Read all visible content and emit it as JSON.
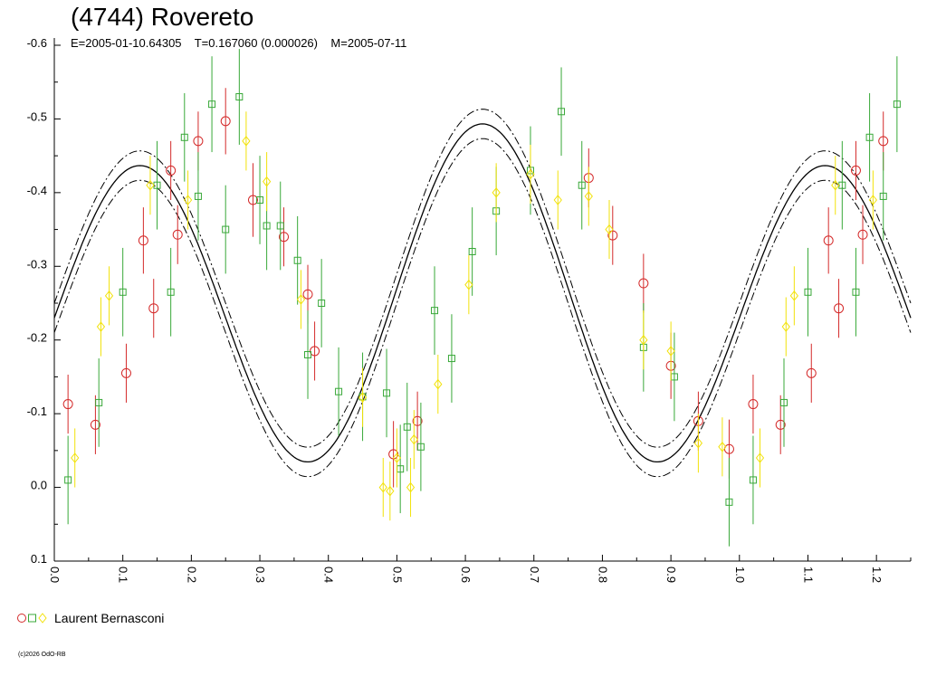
{
  "header": {
    "title": "(4744) Rovereto",
    "subtitle": "E=2005-01-10.64305    T=0.167060 (0.000026)    M=2005-07-11"
  },
  "legend": {
    "label": "Laurent Bernasconi"
  },
  "footer": {
    "copyright": "(c)2026 OdO-RB"
  },
  "colors": {
    "red": "#d42a2a",
    "green": "#38a838",
    "yellow": "#f2e20a"
  },
  "chart_data": {
    "type": "scatter",
    "title": "(4744) Rovereto",
    "xlim": [
      0.0,
      1.25
    ],
    "ylim": [
      -0.6,
      0.1
    ],
    "y_inverted": true,
    "grid": false,
    "x_ticks": [
      "0.0",
      "0.1",
      "0.2",
      "0.3",
      "0.4",
      "0.5",
      "0.6",
      "0.7",
      "0.8",
      "0.9",
      "1.0",
      "1.1",
      "1.2"
    ],
    "y_ticks": [
      "-0.6",
      "-0.5",
      "-0.4",
      "-0.3",
      "-0.2",
      "-0.1",
      "0.0",
      "0.1"
    ],
    "fit_curve": {
      "mean": -0.25,
      "terms": [
        {
          "harmonic": 1,
          "cos": 0.02,
          "sin": 0.02
        },
        {
          "harmonic": 2,
          "cos": 0.0,
          "sin": -0.215
        }
      ],
      "band": 0.02
    },
    "series": [
      {
        "marker": "circle",
        "color": "red",
        "points": [
          {
            "x": 0.02,
            "y": -0.113,
            "err": 0.04
          },
          {
            "x": 0.06,
            "y": -0.085,
            "err": 0.04
          },
          {
            "x": 0.105,
            "y": -0.155,
            "err": 0.04
          },
          {
            "x": 0.13,
            "y": -0.335,
            "err": 0.045
          },
          {
            "x": 0.145,
            "y": -0.243,
            "err": 0.04
          },
          {
            "x": 0.17,
            "y": -0.43,
            "err": 0.04
          },
          {
            "x": 0.18,
            "y": -0.343,
            "err": 0.04
          },
          {
            "x": 0.21,
            "y": -0.47,
            "err": 0.04
          },
          {
            "x": 0.25,
            "y": -0.497,
            "err": 0.045
          },
          {
            "x": 0.29,
            "y": -0.39,
            "err": 0.05
          },
          {
            "x": 0.335,
            "y": -0.34,
            "err": 0.04
          },
          {
            "x": 0.37,
            "y": -0.262,
            "err": 0.04
          },
          {
            "x": 0.38,
            "y": -0.185,
            "err": 0.04
          },
          {
            "x": 0.495,
            "y": -0.045,
            "err": 0.045
          },
          {
            "x": 0.53,
            "y": -0.09,
            "err": 0.04
          },
          {
            "x": 0.78,
            "y": -0.42,
            "err": 0.04
          },
          {
            "x": 0.815,
            "y": -0.342,
            "err": 0.04
          },
          {
            "x": 0.86,
            "y": -0.277,
            "err": 0.04
          },
          {
            "x": 0.9,
            "y": -0.165,
            "err": 0.045
          },
          {
            "x": 0.94,
            "y": -0.09,
            "err": 0.04
          },
          {
            "x": 0.985,
            "y": -0.052,
            "err": 0.04
          },
          {
            "x": 1.02,
            "y": -0.113,
            "err": 0.04
          },
          {
            "x": 1.06,
            "y": -0.085,
            "err": 0.04
          },
          {
            "x": 1.105,
            "y": -0.155,
            "err": 0.04
          },
          {
            "x": 1.13,
            "y": -0.335,
            "err": 0.045
          },
          {
            "x": 1.145,
            "y": -0.243,
            "err": 0.04
          },
          {
            "x": 1.17,
            "y": -0.43,
            "err": 0.04
          },
          {
            "x": 1.18,
            "y": -0.343,
            "err": 0.04
          },
          {
            "x": 1.21,
            "y": -0.47,
            "err": 0.04
          }
        ]
      },
      {
        "marker": "square",
        "color": "green",
        "points": [
          {
            "x": 0.02,
            "y": -0.01,
            "err": 0.06
          },
          {
            "x": 0.065,
            "y": -0.115,
            "err": 0.06
          },
          {
            "x": 0.1,
            "y": -0.265,
            "err": 0.06
          },
          {
            "x": 0.15,
            "y": -0.41,
            "err": 0.06
          },
          {
            "x": 0.17,
            "y": -0.265,
            "err": 0.06
          },
          {
            "x": 0.19,
            "y": -0.475,
            "err": 0.06
          },
          {
            "x": 0.21,
            "y": -0.395,
            "err": 0.06
          },
          {
            "x": 0.23,
            "y": -0.52,
            "err": 0.065
          },
          {
            "x": 0.25,
            "y": -0.35,
            "err": 0.06
          },
          {
            "x": 0.27,
            "y": -0.53,
            "err": 0.065
          },
          {
            "x": 0.3,
            "y": -0.39,
            "err": 0.06
          },
          {
            "x": 0.31,
            "y": -0.355,
            "err": 0.06
          },
          {
            "x": 0.33,
            "y": -0.355,
            "err": 0.06
          },
          {
            "x": 0.355,
            "y": -0.308,
            "err": 0.06
          },
          {
            "x": 0.37,
            "y": -0.18,
            "err": 0.06
          },
          {
            "x": 0.39,
            "y": -0.25,
            "err": 0.06
          },
          {
            "x": 0.415,
            "y": -0.13,
            "err": 0.06
          },
          {
            "x": 0.45,
            "y": -0.123,
            "err": 0.06
          },
          {
            "x": 0.485,
            "y": -0.128,
            "err": 0.06
          },
          {
            "x": 0.505,
            "y": -0.025,
            "err": 0.06
          },
          {
            "x": 0.515,
            "y": -0.082,
            "err": 0.06
          },
          {
            "x": 0.535,
            "y": -0.055,
            "err": 0.06
          },
          {
            "x": 0.555,
            "y": -0.24,
            "err": 0.06
          },
          {
            "x": 0.58,
            "y": -0.175,
            "err": 0.06
          },
          {
            "x": 0.61,
            "y": -0.32,
            "err": 0.06
          },
          {
            "x": 0.645,
            "y": -0.375,
            "err": 0.06
          },
          {
            "x": 0.695,
            "y": -0.43,
            "err": 0.06
          },
          {
            "x": 0.74,
            "y": -0.51,
            "err": 0.06
          },
          {
            "x": 0.77,
            "y": -0.41,
            "err": 0.06
          },
          {
            "x": 0.86,
            "y": -0.19,
            "err": 0.06
          },
          {
            "x": 0.905,
            "y": -0.15,
            "err": 0.06
          },
          {
            "x": 0.985,
            "y": 0.02,
            "err": 0.06
          },
          {
            "x": 1.02,
            "y": -0.01,
            "err": 0.06
          },
          {
            "x": 1.065,
            "y": -0.115,
            "err": 0.06
          },
          {
            "x": 1.1,
            "y": -0.265,
            "err": 0.06
          },
          {
            "x": 1.15,
            "y": -0.41,
            "err": 0.06
          },
          {
            "x": 1.17,
            "y": -0.265,
            "err": 0.06
          },
          {
            "x": 1.19,
            "y": -0.475,
            "err": 0.06
          },
          {
            "x": 1.21,
            "y": -0.395,
            "err": 0.06
          },
          {
            "x": 1.23,
            "y": -0.52,
            "err": 0.065
          }
        ]
      },
      {
        "marker": "diamond",
        "color": "yellow",
        "points": [
          {
            "x": 0.03,
            "y": -0.04,
            "err": 0.04
          },
          {
            "x": 0.068,
            "y": -0.218,
            "err": 0.04
          },
          {
            "x": 0.08,
            "y": -0.26,
            "err": 0.04
          },
          {
            "x": 0.14,
            "y": -0.41,
            "err": 0.04
          },
          {
            "x": 0.195,
            "y": -0.39,
            "err": 0.04
          },
          {
            "x": 0.28,
            "y": -0.47,
            "err": 0.04
          },
          {
            "x": 0.31,
            "y": -0.415,
            "err": 0.04
          },
          {
            "x": 0.36,
            "y": -0.255,
            "err": 0.04
          },
          {
            "x": 0.45,
            "y": -0.122,
            "err": 0.04
          },
          {
            "x": 0.48,
            "y": 0.0,
            "err": 0.04
          },
          {
            "x": 0.49,
            "y": 0.005,
            "err": 0.04
          },
          {
            "x": 0.5,
            "y": -0.04,
            "err": 0.04
          },
          {
            "x": 0.52,
            "y": 0.0,
            "err": 0.04
          },
          {
            "x": 0.525,
            "y": -0.065,
            "err": 0.04
          },
          {
            "x": 0.56,
            "y": -0.14,
            "err": 0.04
          },
          {
            "x": 0.605,
            "y": -0.275,
            "err": 0.04
          },
          {
            "x": 0.645,
            "y": -0.4,
            "err": 0.04
          },
          {
            "x": 0.695,
            "y": -0.425,
            "err": 0.04
          },
          {
            "x": 0.735,
            "y": -0.39,
            "err": 0.04
          },
          {
            "x": 0.78,
            "y": -0.395,
            "err": 0.04
          },
          {
            "x": 0.81,
            "y": -0.35,
            "err": 0.04
          },
          {
            "x": 0.86,
            "y": -0.2,
            "err": 0.04
          },
          {
            "x": 0.9,
            "y": -0.185,
            "err": 0.04
          },
          {
            "x": 0.94,
            "y": -0.06,
            "err": 0.04
          },
          {
            "x": 0.975,
            "y": -0.055,
            "err": 0.04
          },
          {
            "x": 1.03,
            "y": -0.04,
            "err": 0.04
          },
          {
            "x": 1.068,
            "y": -0.218,
            "err": 0.04
          },
          {
            "x": 1.08,
            "y": -0.26,
            "err": 0.04
          },
          {
            "x": 1.14,
            "y": -0.41,
            "err": 0.04
          },
          {
            "x": 1.195,
            "y": -0.39,
            "err": 0.04
          }
        ]
      }
    ]
  }
}
